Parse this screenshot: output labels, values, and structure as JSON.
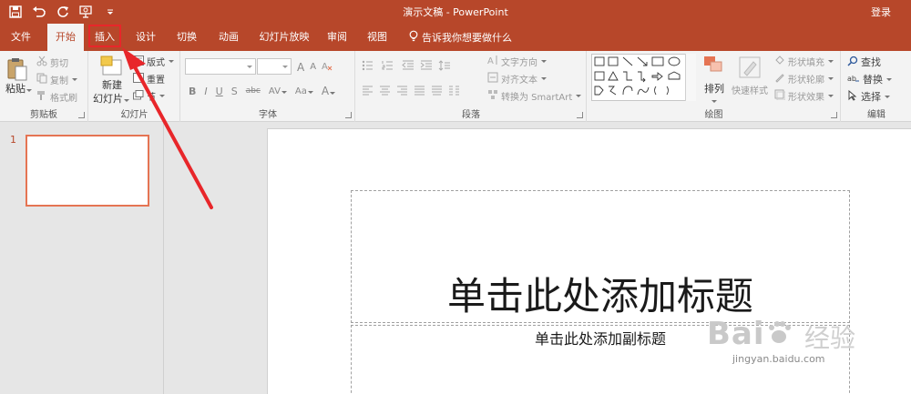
{
  "window": {
    "title": "演示文稿  -  PowerPoint",
    "login": "登录"
  },
  "tabs": [
    {
      "label": "文件"
    },
    {
      "label": "开始"
    },
    {
      "label": "插入"
    },
    {
      "label": "设计"
    },
    {
      "label": "切换"
    },
    {
      "label": "动画"
    },
    {
      "label": "幻灯片放映"
    },
    {
      "label": "审阅"
    },
    {
      "label": "视图"
    }
  ],
  "tellme": "告诉我你想要做什么",
  "ribbon": {
    "clipboard": {
      "label": "剪贴板",
      "paste": "粘贴",
      "cut": "剪切",
      "copy": "复制",
      "painter": "格式刷"
    },
    "slides": {
      "label": "幻灯片",
      "new_slide_line1": "新建",
      "new_slide_line2": "幻灯片",
      "layout": "版式",
      "reset": "重置",
      "section": "节"
    },
    "font": {
      "label": "字体",
      "bold": "B",
      "italic": "I",
      "underline": "U",
      "shadow": "S",
      "strike": "abc",
      "spacing": "AV",
      "case": "Aa",
      "color": "A",
      "grow": "A",
      "shrink": "A"
    },
    "paragraph": {
      "label": "段落",
      "text_direction": "文字方向",
      "align_text": "对齐文本",
      "smartart": "转换为 SmartArt"
    },
    "drawing": {
      "label": "绘图",
      "arrange": "排列",
      "quick_styles": "快速样式",
      "fill": "形状填充",
      "outline": "形状轮廓",
      "effects": "形状效果"
    },
    "editing": {
      "label": "编辑",
      "find": "查找",
      "replace": "替换",
      "select": "选择"
    }
  },
  "slide_panel": {
    "number": "1"
  },
  "slide": {
    "title_placeholder": "单击此处添加标题",
    "subtitle_placeholder": "单击此处添加副标题"
  },
  "watermark": {
    "brand": "Bai",
    "brand_suffix": "经验",
    "url": "jingyan.baidu.com"
  },
  "colors": {
    "accent": "#b7472a",
    "highlight": "#e8262a",
    "thumb_border": "#e57453"
  }
}
